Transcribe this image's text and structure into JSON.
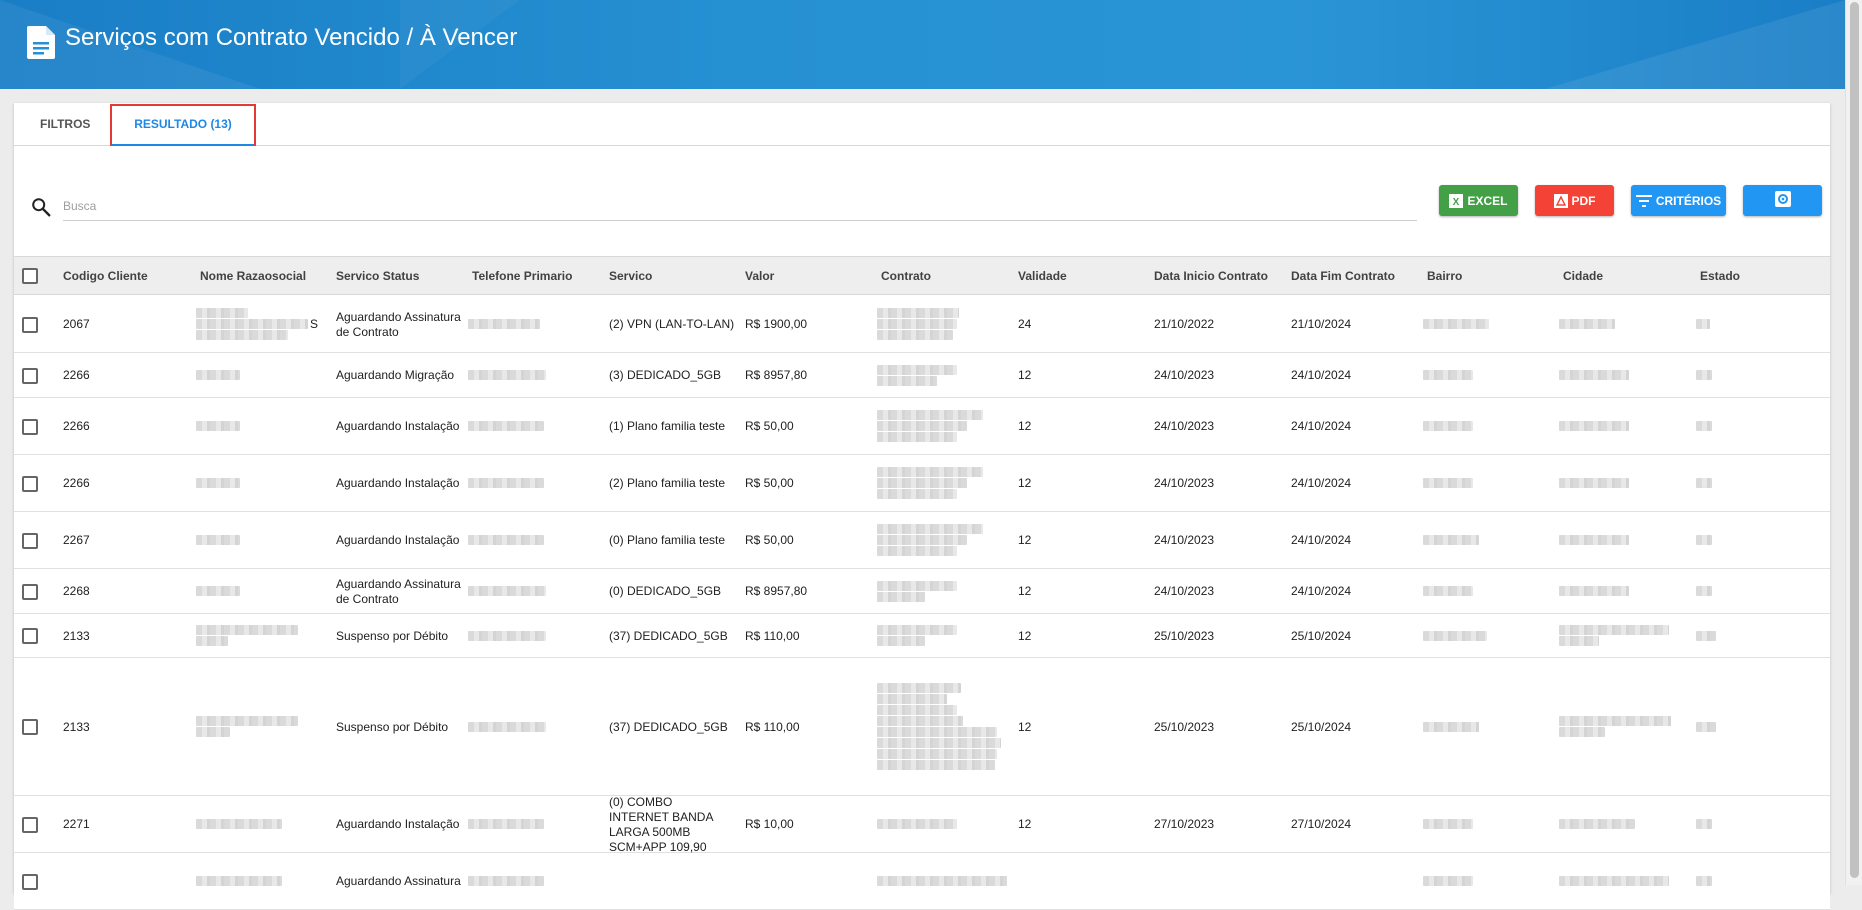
{
  "header": {
    "title": "Serviços com Contrato Vencido / À Vencer",
    "icon": "document-icon"
  },
  "tabs": [
    {
      "label": "FILTROS",
      "active": false
    },
    {
      "label": "RESULTADO (13)",
      "active": true
    }
  ],
  "search": {
    "placeholder": "Busca",
    "value": ""
  },
  "toolbar": {
    "excel_label": "EXCEL",
    "pdf_label": "PDF",
    "criterios_label": "CRITÉRIOS"
  },
  "colors": {
    "accent": "#1e88e5",
    "excel": "#43a047",
    "pdf": "#f44336",
    "header": "#2590d2"
  },
  "table": {
    "columns": [
      "Codigo Cliente",
      "Nome Razaosocial",
      "Servico Status",
      "Telefone Primario",
      "Servico",
      "Valor",
      "Contrato",
      "Validade",
      "Data Inicio Contrato",
      "Data Fim Contrato",
      "Bairro",
      "Cidade",
      "Estado"
    ],
    "rows": [
      {
        "codigo": "2067",
        "nome_suffix": "S",
        "status": "Aguardando Assinatura de Contrato",
        "servico": "(2) VPN (LAN-TO-LAN)",
        "valor": "R$ 1900,00",
        "validade": "24",
        "inicio": "21/10/2022",
        "fim": "21/10/2024"
      },
      {
        "codigo": "2266",
        "nome_suffix": "",
        "status": "Aguardando Migração",
        "servico": "(3) DEDICADO_5GB",
        "valor": "R$ 8957,80",
        "validade": "12",
        "inicio": "24/10/2023",
        "fim": "24/10/2024"
      },
      {
        "codigo": "2266",
        "nome_suffix": "",
        "status": "Aguardando Instalação",
        "servico": "(1) Plano familia teste",
        "valor": "R$ 50,00",
        "validade": "12",
        "inicio": "24/10/2023",
        "fim": "24/10/2024"
      },
      {
        "codigo": "2266",
        "nome_suffix": "",
        "status": "Aguardando Instalação",
        "servico": "(2) Plano familia teste",
        "valor": "R$ 50,00",
        "validade": "12",
        "inicio": "24/10/2023",
        "fim": "24/10/2024"
      },
      {
        "codigo": "2267",
        "nome_suffix": "",
        "status": "Aguardando Instalação",
        "servico": "(0) Plano familia teste",
        "valor": "R$ 50,00",
        "validade": "12",
        "inicio": "24/10/2023",
        "fim": "24/10/2024"
      },
      {
        "codigo": "2268",
        "nome_suffix": "",
        "status": "Aguardando Assinatura de Contrato",
        "servico": "(0) DEDICADO_5GB",
        "valor": "R$ 8957,80",
        "validade": "12",
        "inicio": "24/10/2023",
        "fim": "24/10/2024"
      },
      {
        "codigo": "2133",
        "nome_suffix": "",
        "status": "Suspenso por Débito",
        "servico": "(37) DEDICADO_5GB",
        "valor": "R$ 110,00",
        "validade": "12",
        "inicio": "25/10/2023",
        "fim": "25/10/2024"
      },
      {
        "codigo": "2133",
        "nome_suffix": "",
        "status": "Suspenso por Débito",
        "servico": "(37) DEDICADO_5GB",
        "valor": "R$ 110,00",
        "validade": "12",
        "inicio": "25/10/2023",
        "fim": "25/10/2024"
      },
      {
        "codigo": "2271",
        "nome_suffix": "",
        "status": "Aguardando Instalação",
        "servico": "(0) COMBO INTERNET BANDA LARGA 500MB SCM+APP 109,90",
        "valor": "R$ 10,00",
        "validade": "12",
        "inicio": "27/10/2023",
        "fim": "27/10/2024"
      },
      {
        "codigo": "",
        "nome_suffix": "",
        "status": "Aguardando Assinatura",
        "servico": "",
        "valor": "",
        "validade": "",
        "inicio": "",
        "fim": ""
      }
    ]
  }
}
